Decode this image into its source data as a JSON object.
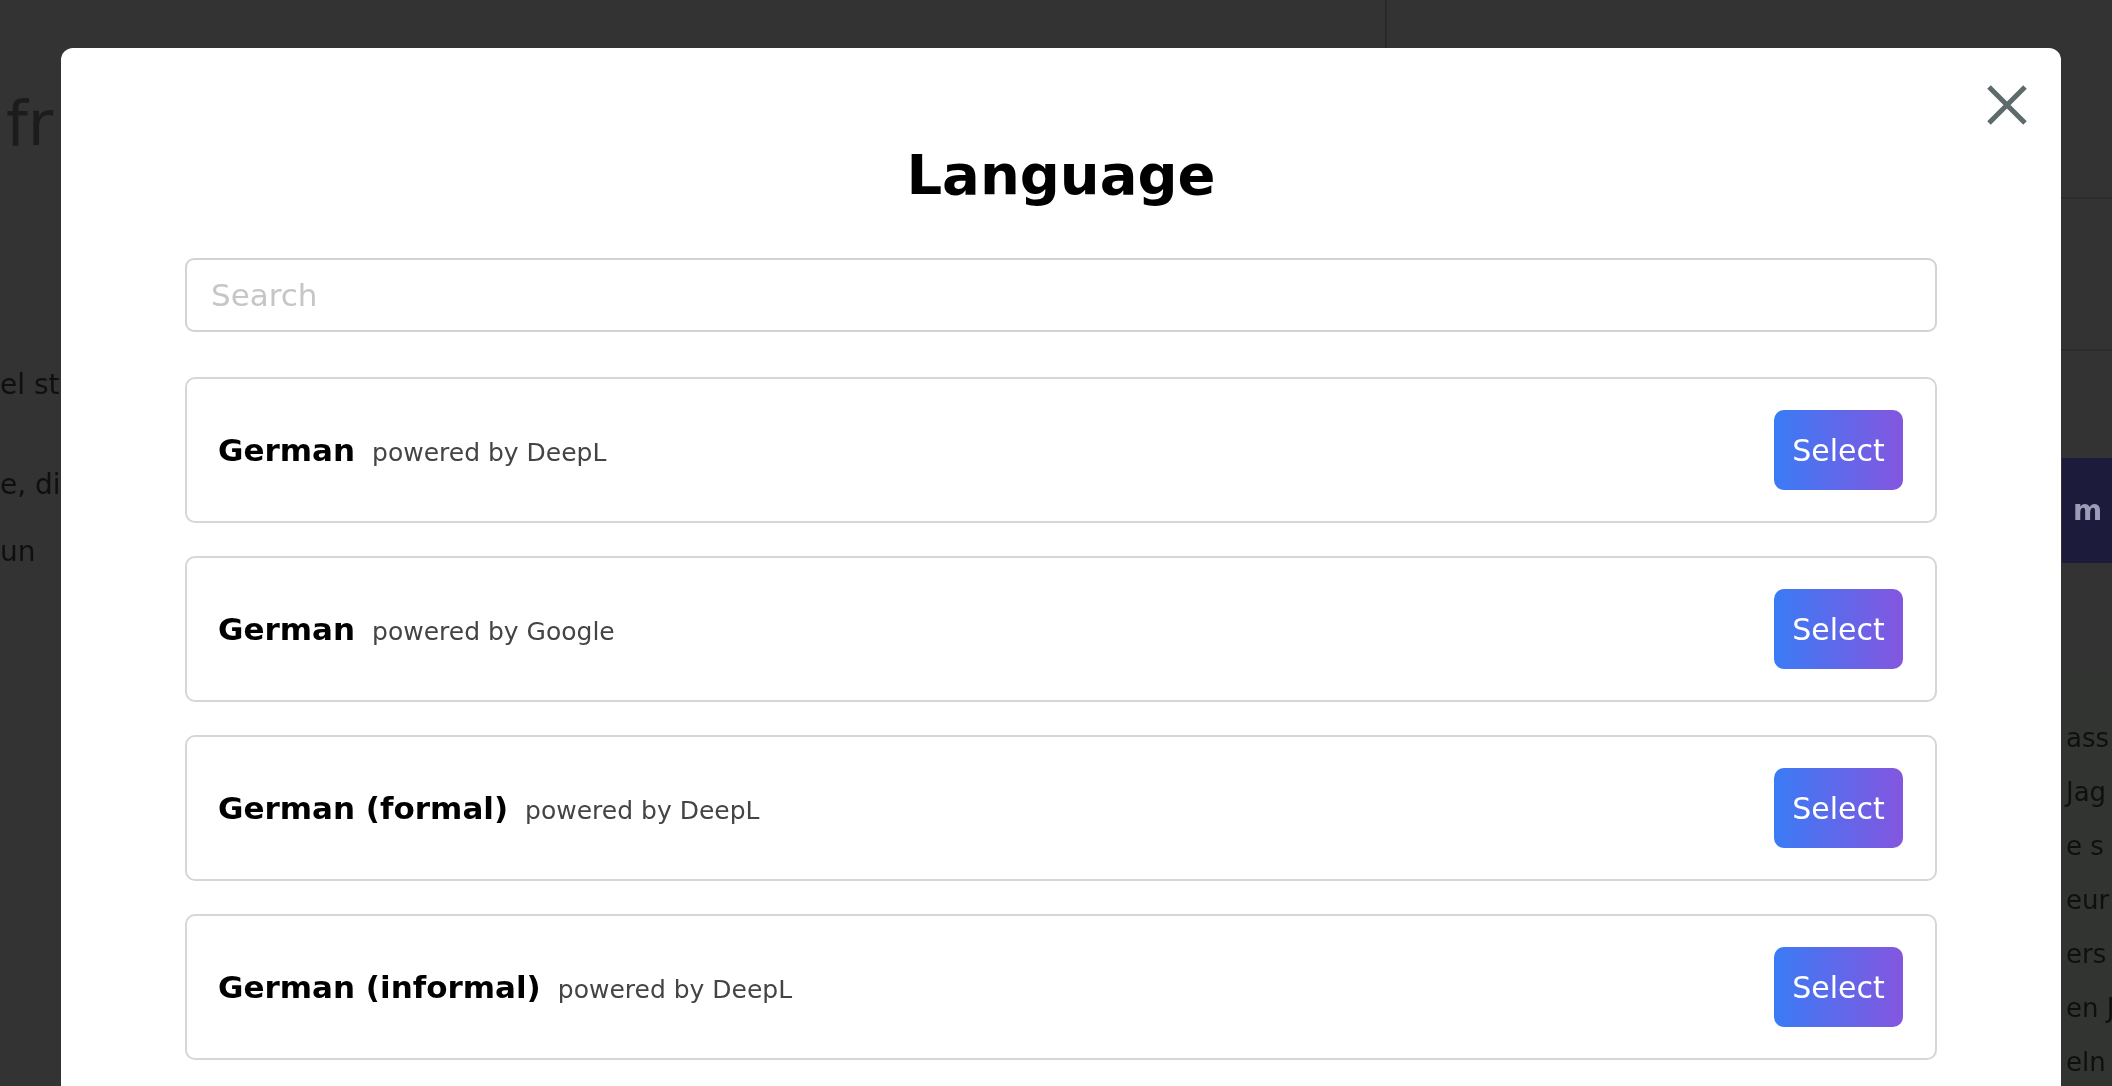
{
  "background_page": {
    "heading_fragment": "fr",
    "left_paragraphs": [
      {
        "lines": [
          "el st"
        ]
      },
      {
        "lines": [
          "e, di",
          "un"
        ]
      }
    ],
    "banner_fragment": "m",
    "right_lines": [
      "ass",
      "Jag",
      "e s",
      "eur",
      "ers",
      "en J",
      "eln"
    ]
  },
  "dialog": {
    "title": "Language",
    "search": {
      "placeholder": "Search"
    },
    "languages": [
      {
        "name": "German",
        "provider": "powered by DeepL",
        "action": "Select"
      },
      {
        "name": "German",
        "provider": "powered by Google",
        "action": "Select"
      },
      {
        "name": "German (formal)",
        "provider": "powered by DeepL",
        "action": "Select"
      },
      {
        "name": "German (informal)",
        "provider": "powered by DeepL",
        "action": "Select"
      }
    ]
  }
}
